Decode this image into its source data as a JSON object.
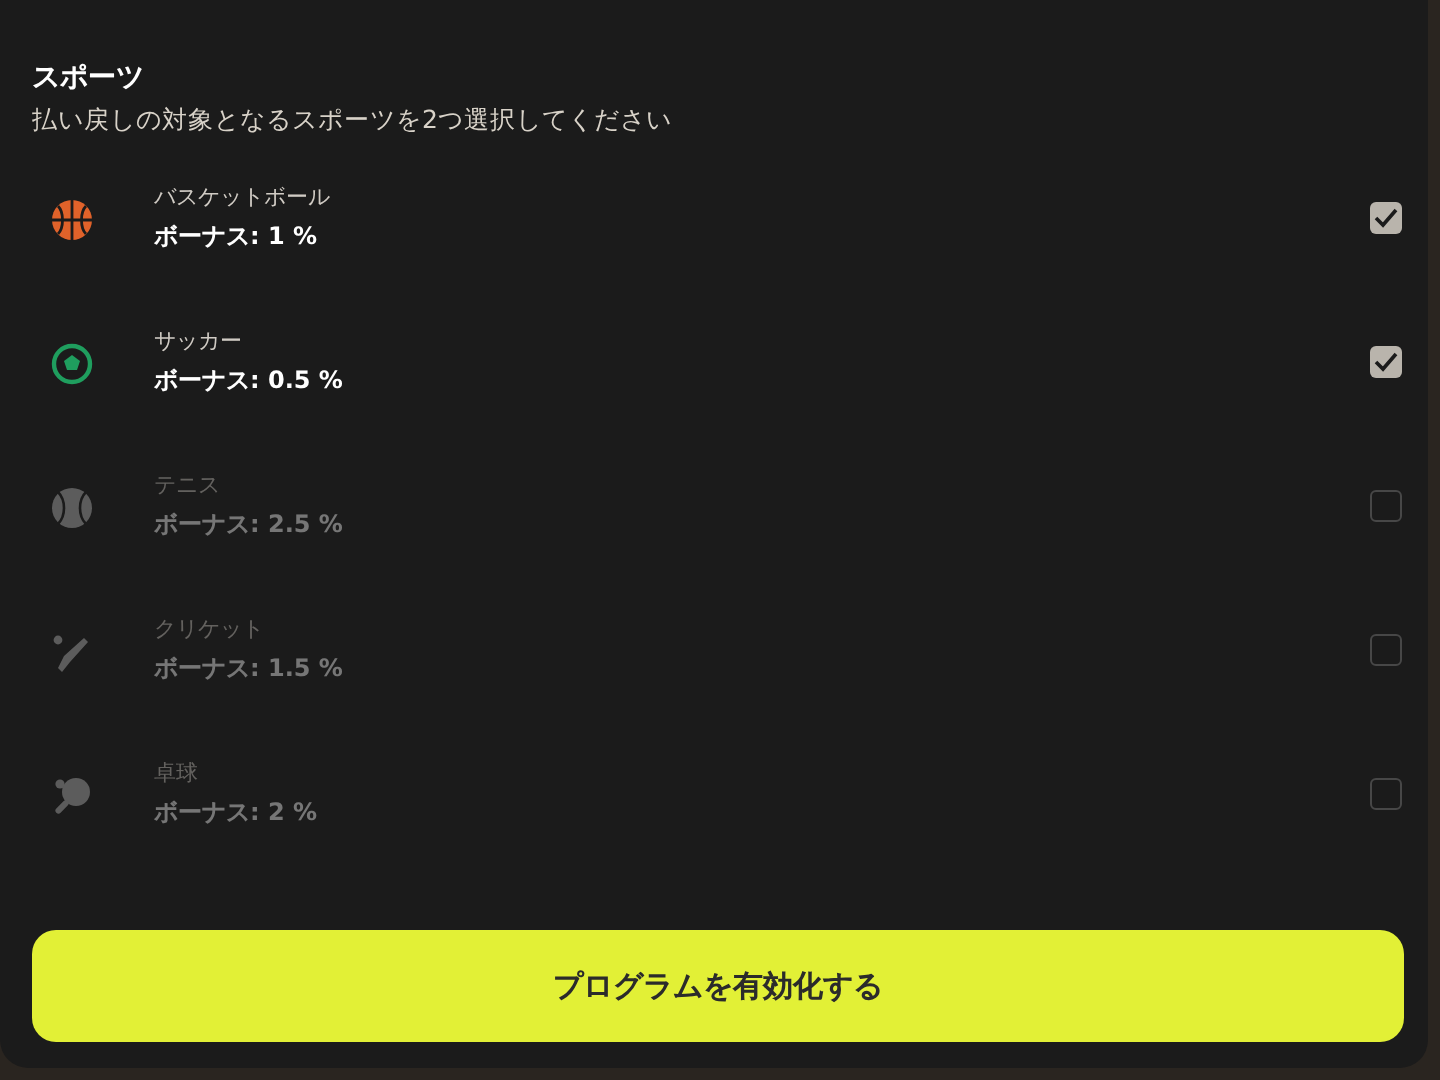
{
  "title": "スポーツ",
  "subtitle": "払い戻しの対象となるスポーツを2つ選択してください",
  "sports": [
    {
      "kind": "basketball",
      "color": "#e0622a",
      "name": "バスケットボール",
      "bonus": "ボーナス: 1 %",
      "checked": true,
      "disabled": false
    },
    {
      "kind": "soccer",
      "color": "#1f9e5e",
      "name": "サッカー",
      "bonus": "ボーナス: 0.5 %",
      "checked": true,
      "disabled": false
    },
    {
      "kind": "tennis",
      "color": "#5c5c5c",
      "name": "テニス",
      "bonus": "ボーナス: 2.5 %",
      "checked": false,
      "disabled": true
    },
    {
      "kind": "cricket",
      "color": "#5c5c5c",
      "name": "クリケット",
      "bonus": "ボーナス: 1.5 %",
      "checked": false,
      "disabled": true
    },
    {
      "kind": "pingpong",
      "color": "#5c5c5c",
      "name": "卓球",
      "bonus": "ボーナス: 2 %",
      "checked": false,
      "disabled": true
    }
  ],
  "button": "プログラムを有効化する"
}
